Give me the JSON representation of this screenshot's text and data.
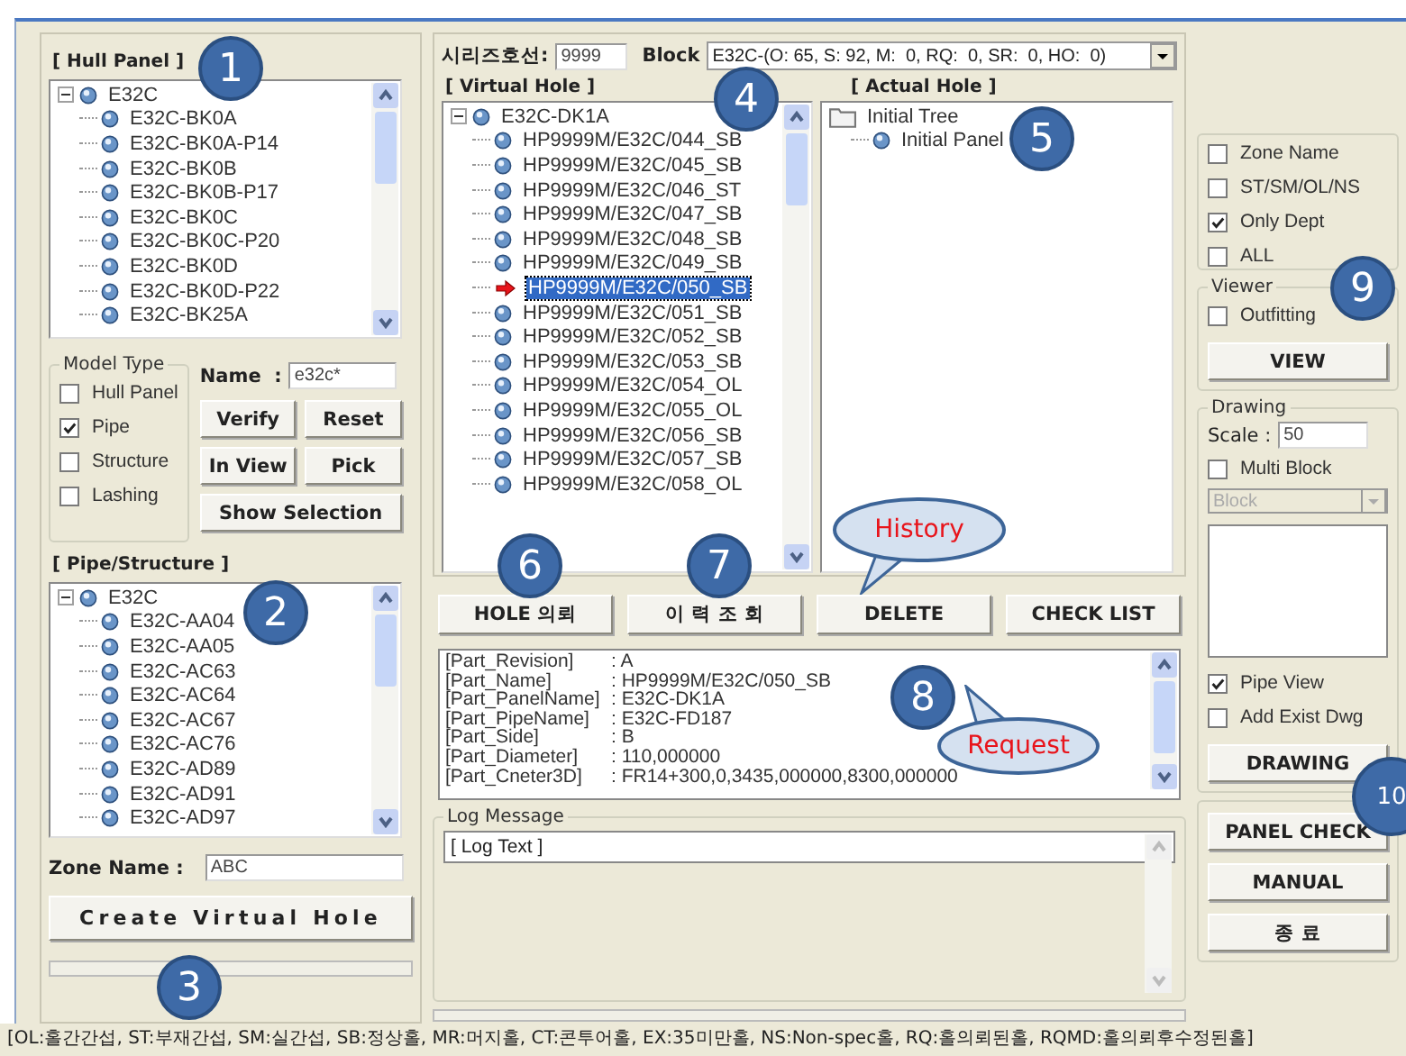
{
  "hull_panel": {
    "title": "[ Hull Panel ]",
    "tree": {
      "label": "E32C",
      "expanded": true,
      "children": [
        {
          "label": "E32C-BK0A"
        },
        {
          "label": "E32C-BK0A-P14"
        },
        {
          "label": "E32C-BK0B"
        },
        {
          "label": "E32C-BK0B-P17"
        },
        {
          "label": "E32C-BK0C"
        },
        {
          "label": "E32C-BK0C-P20"
        },
        {
          "label": "E32C-BK0D"
        },
        {
          "label": "E32C-BK0D-P22"
        },
        {
          "label": "E32C-BK25A"
        }
      ]
    }
  },
  "model_type": {
    "title": "Model Type",
    "options": [
      {
        "label": "Hull Panel",
        "checked": false
      },
      {
        "label": "Pipe",
        "checked": true
      },
      {
        "label": "Structure",
        "checked": false
      },
      {
        "label": "Lashing",
        "checked": false
      }
    ]
  },
  "name_field": {
    "label": "Name  :",
    "value": "e32c*"
  },
  "left_buttons": [
    "Verify",
    "Reset",
    "In View",
    "Pick",
    "Show Selection"
  ],
  "pipe_structure": {
    "title": "[ Pipe/Structure ]",
    "tree": {
      "label": "E32C",
      "expanded": true,
      "children": [
        {
          "label": "E32C-AA04"
        },
        {
          "label": "E32C-AA05"
        },
        {
          "label": "E32C-AC63"
        },
        {
          "label": "E32C-AC64"
        },
        {
          "label": "E32C-AC67"
        },
        {
          "label": "E32C-AC76"
        },
        {
          "label": "E32C-AD89"
        },
        {
          "label": "E32C-AD91"
        },
        {
          "label": "E32C-AD97"
        }
      ]
    }
  },
  "zone_name": {
    "label": "Zone Name :",
    "value": "ABC"
  },
  "create_button": "Create Virtual Hole",
  "series_field": {
    "label": "시리즈호선:",
    "value": "9999"
  },
  "block_select": {
    "label": "Block",
    "value": "E32C-(O: 65, S: 92, M:  0, RQ:  0, SR:  0, HO:  0)"
  },
  "virtual_hole": {
    "title": "[ Virtual Hole ]",
    "tree": {
      "label": "E32C-DK1A",
      "expanded": true,
      "children": [
        {
          "label": "HP9999M/E32C/044_SB",
          "selected": false
        },
        {
          "label": "HP9999M/E32C/045_SB",
          "selected": false
        },
        {
          "label": "HP9999M/E32C/046_ST",
          "selected": false
        },
        {
          "label": "HP9999M/E32C/047_SB",
          "selected": false
        },
        {
          "label": "HP9999M/E32C/048_SB",
          "selected": false
        },
        {
          "label": "HP9999M/E32C/049_SB",
          "selected": false
        },
        {
          "label": "HP9999M/E32C/050_SB",
          "selected": true
        },
        {
          "label": "HP9999M/E32C/051_SB",
          "selected": false
        },
        {
          "label": "HP9999M/E32C/052_SB",
          "selected": false
        },
        {
          "label": "HP9999M/E32C/053_SB",
          "selected": false
        },
        {
          "label": "HP9999M/E32C/054_OL",
          "selected": false
        },
        {
          "label": "HP9999M/E32C/055_OL",
          "selected": false
        },
        {
          "label": "HP9999M/E32C/056_SB",
          "selected": false
        },
        {
          "label": "HP9999M/E32C/057_SB",
          "selected": false
        },
        {
          "label": "HP9999M/E32C/058_OL",
          "selected": false
        }
      ]
    }
  },
  "actual_hole": {
    "title": "[ Actual Hole ]",
    "tree": {
      "label": "Initial Tree",
      "expanded": true,
      "children": [
        {
          "label": "Initial Panel"
        }
      ]
    }
  },
  "action_buttons": [
    "HOLE 의뢰",
    "이 력 조 회",
    "DELETE",
    "CHECK LIST"
  ],
  "part_info": [
    {
      "key": "[Part_Revision]",
      "value": ": A"
    },
    {
      "key": "[Part_Name]",
      "value": ": HP9999M/E32C/050_SB"
    },
    {
      "key": "[Part_PanelName]",
      "value": ": E32C-DK1A"
    },
    {
      "key": "[Part_PipeName]",
      "value": ": E32C-FD187"
    },
    {
      "key": "[Part_Side]",
      "value": ": B"
    },
    {
      "key": "[Part_Diameter]",
      "value": ": 110,000000"
    },
    {
      "key": "[Part_Cneter3D]",
      "value": ": FR14+300,0,3435,000000,8300,000000"
    }
  ],
  "log": {
    "title": "Log Message",
    "text": "[ Log Text ]"
  },
  "filters": [
    {
      "label": "Zone Name",
      "checked": false
    },
    {
      "label": "ST/SM/OL/NS",
      "checked": false
    },
    {
      "label": "Only Dept",
      "checked": true
    },
    {
      "label": "ALL",
      "checked": false
    }
  ],
  "viewer": {
    "title": "Viewer",
    "option": {
      "label": "Outfitting",
      "checked": false
    },
    "button": "VIEW"
  },
  "drawing": {
    "title": "Drawing",
    "scale_label": "Scale :",
    "scale_value": "50",
    "multi_block": {
      "label": "Multi Block",
      "checked": false
    },
    "block_select": {
      "value": "Block",
      "disabled": true
    },
    "options": [
      {
        "label": "Pipe View",
        "checked": true
      },
      {
        "label": "Add Exist Dwg",
        "checked": false
      }
    ],
    "button": "DRAWING"
  },
  "side_buttons": [
    "PANEL CHECK",
    "MANUAL",
    "종 료"
  ],
  "status_bar": "[OL:홀간간섭, ST:부재간섭, SM:실간섭, SB:정상홀, MR:머지홀, CT:콘투어홀, EX:35미만홀, NS:Non-spec홀, RQ:홀의뢰된홀, RQMD:홀의뢰후수정된홀]",
  "annotations": [
    {
      "kind": "marker",
      "text": "1"
    },
    {
      "kind": "marker",
      "text": "2"
    },
    {
      "kind": "marker",
      "text": "3"
    },
    {
      "kind": "marker",
      "text": "4"
    },
    {
      "kind": "marker",
      "text": "5"
    },
    {
      "kind": "marker",
      "text": "6"
    },
    {
      "kind": "marker",
      "text": "7"
    },
    {
      "kind": "marker",
      "text": "8"
    },
    {
      "kind": "marker",
      "text": "9"
    },
    {
      "kind": "marker",
      "text": "10"
    },
    {
      "kind": "callout",
      "text": "History"
    },
    {
      "kind": "callout",
      "text": "Request"
    }
  ]
}
